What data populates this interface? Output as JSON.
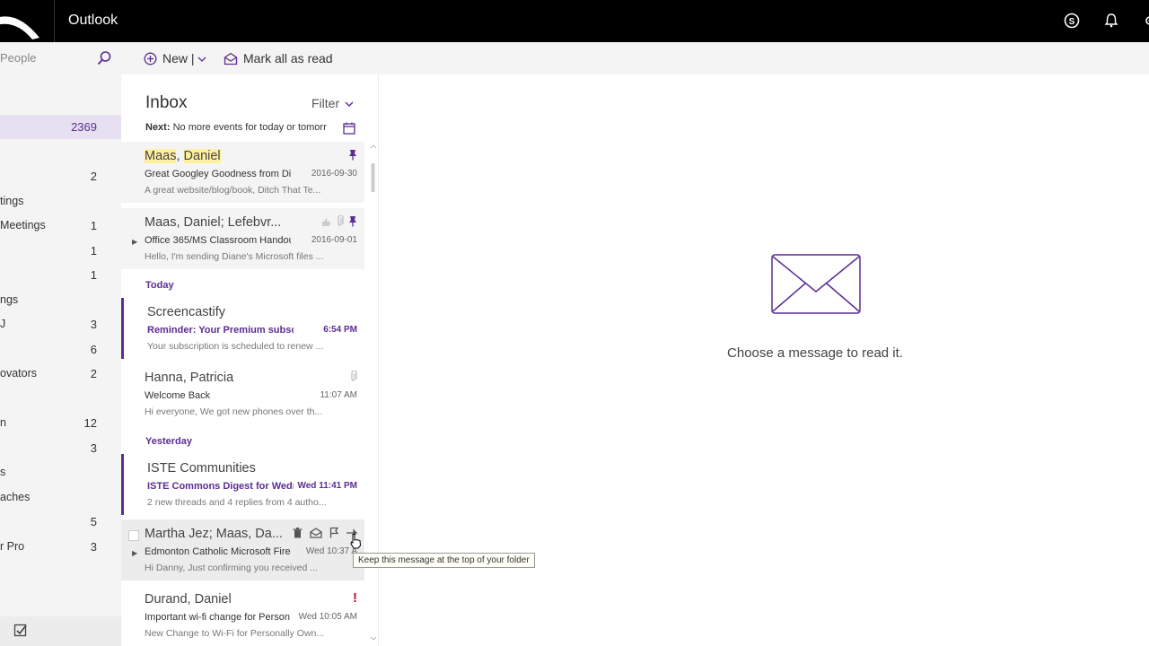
{
  "app": {
    "title": "Outlook"
  },
  "toolbar": {
    "new_label": "New |",
    "mark_all_read_label": "Mark all as read"
  },
  "search": {
    "placeholder": "People"
  },
  "folders": [
    {
      "label": "",
      "count": "2369",
      "selected": true
    },
    {
      "label": "",
      "count": ""
    },
    {
      "label": "",
      "count": "2"
    },
    {
      "label": "tings",
      "count": ""
    },
    {
      "label": "Meetings",
      "count": "1"
    },
    {
      "label": "",
      "count": "1"
    },
    {
      "label": "",
      "count": "1"
    },
    {
      "label": "ngs",
      "count": ""
    },
    {
      "label": "J",
      "count": "3"
    },
    {
      "label": "",
      "count": "6"
    },
    {
      "label": "ovators",
      "count": "2"
    },
    {
      "label": "",
      "count": ""
    },
    {
      "label": "n",
      "count": "12"
    },
    {
      "label": "",
      "count": "3"
    },
    {
      "label": "s",
      "count": ""
    },
    {
      "label": "aches",
      "count": ""
    },
    {
      "label": "",
      "count": "5"
    },
    {
      "label": "r Pro",
      "count": "3"
    }
  ],
  "inbox": {
    "title": "Inbox",
    "filter_label": "Filter",
    "next_label": "Next:",
    "next_text": "No more events for today or tomorr"
  },
  "sections": {
    "today": "Today",
    "yesterday": "Yesterday"
  },
  "messages": [
    {
      "sender_a": "Maas",
      "sender_sep": ", ",
      "sender_b": "Daniel",
      "subject": "Great Googley Goodness from Di",
      "time": "2016-09-30",
      "preview": "A great website/blog/book, Ditch That Te..."
    },
    {
      "sender": "Maas, Daniel; Lefebvr...",
      "subject": "Office 365/MS Classroom Handou",
      "time": "2016-09-01",
      "preview": "Hello, I'm sending Diane's Microsoft files ..."
    },
    {
      "sender": "Screencastify",
      "subject": "Reminder: Your Premium subscri",
      "time": "6:54 PM",
      "preview": "Your subscription is scheduled to renew ..."
    },
    {
      "sender": "Hanna, Patricia",
      "subject": "Welcome Back",
      "time": "11:07 AM",
      "preview": "Hi everyone, We got new phones over th..."
    },
    {
      "sender": "ISTE Communities",
      "subject": "ISTE Commons Digest for Wedne",
      "time": "Wed 11:41 PM",
      "preview": "2 new threads and 4 replies from 4 autho..."
    },
    {
      "sender": "Martha Jez; Maas, Da...",
      "subject": "Edmonton Catholic Microsoft Fire",
      "time": "Wed 10:37 A",
      "preview": "Hi Danny,   Just confirming you received ..."
    },
    {
      "sender": "Durand, Daniel",
      "subject": "Important wi-fi change for Person",
      "time": "Wed 10:05 AM",
      "preview": "New Change to Wi-Fi for Personally Own..."
    }
  ],
  "reading": {
    "empty_text": "Choose a message to read it."
  },
  "tooltip": {
    "text": "Keep this message at the top of your folder"
  },
  "colors": {
    "accent": "#5c2d91",
    "topbar": "#000000",
    "flag_red": "#c50f1f"
  }
}
